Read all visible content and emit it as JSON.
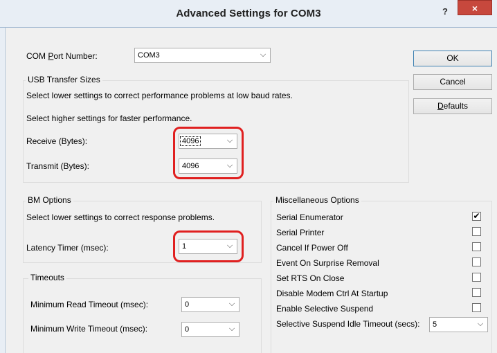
{
  "window": {
    "title": "Advanced Settings for COM3",
    "help_label": "?",
    "close_label": "×"
  },
  "com_port": {
    "label_pre": "COM ",
    "label_accel": "P",
    "label_post": "ort Number:",
    "value": "COM3"
  },
  "buttons": {
    "ok": "OK",
    "cancel": "Cancel",
    "defaults_accel": "D",
    "defaults_rest": "efaults"
  },
  "usb": {
    "title": "USB Transfer Sizes",
    "desc1": "Select lower settings to correct performance problems at low baud rates.",
    "desc2": "Select higher settings for faster performance.",
    "receive_label": "Receive (Bytes):",
    "receive_value": "4096",
    "transmit_label": "Transmit (Bytes):",
    "transmit_value": "4096"
  },
  "bm": {
    "title": "BM Options",
    "desc": "Select lower settings to correct response problems.",
    "latency_label": "Latency Timer (msec):",
    "latency_value": "1"
  },
  "timeouts": {
    "title": "Timeouts",
    "min_read_label": "Minimum Read Timeout (msec):",
    "min_read_value": "0",
    "min_write_label": "Minimum Write Timeout (msec):",
    "min_write_value": "0"
  },
  "misc": {
    "title": "Miscellaneous Options",
    "options": [
      {
        "label": "Serial Enumerator",
        "checked": true
      },
      {
        "label": "Serial Printer",
        "checked": false
      },
      {
        "label": "Cancel If Power Off",
        "checked": false
      },
      {
        "label": "Event On Surprise Removal",
        "checked": false
      },
      {
        "label": "Set RTS On Close",
        "checked": false
      },
      {
        "label": "Disable Modem Ctrl At Startup",
        "checked": false
      },
      {
        "label": "Enable Selective Suspend",
        "checked": false
      }
    ],
    "idle_label": "Selective Suspend Idle Timeout (secs):",
    "idle_value": "5"
  },
  "glyphs": {
    "dropdown": "⌵",
    "check": "✔"
  },
  "colors": {
    "highlight": "#e02020",
    "close_button": "#c7483d",
    "titlebar": "#e8eef5"
  }
}
